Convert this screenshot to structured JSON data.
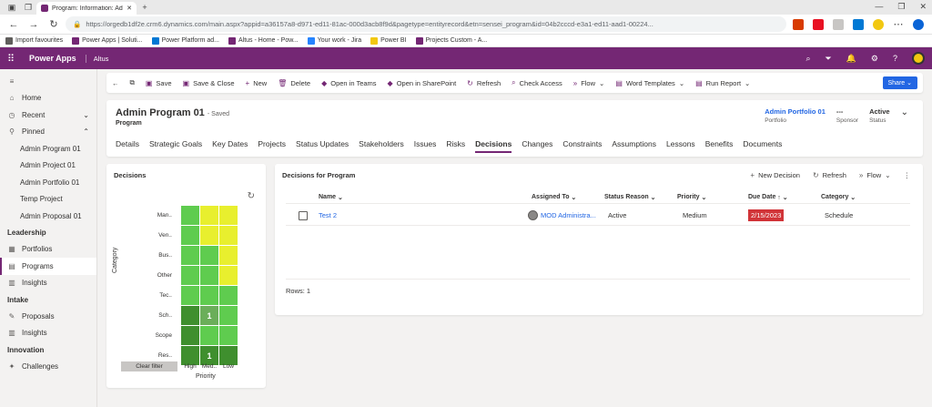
{
  "browser": {
    "tab_title": "Program: Information: Admin Pr",
    "url": "https://orgedb1df2e.crm6.dynamics.com/main.aspx?appid=a36157a8-d971-ed11-81ac-000d3acb8f9d&pagetype=entityrecord&etn=sensei_program&id=04b2cccd-e3a1-ed11-aad1-00224...",
    "bookmarks": [
      "Import favourites",
      "Power Apps | Soluti...",
      "Power Platform ad...",
      "Altus - Home - Pow...",
      "Your work - Jira",
      "Power BI",
      "Projects Custom - A..."
    ]
  },
  "app": {
    "name": "Power Apps",
    "environment": "Altus"
  },
  "sidebar": {
    "top": [
      {
        "label": "Home",
        "icon": "home-icon"
      },
      {
        "label": "Recent",
        "icon": "clock-icon"
      },
      {
        "label": "Pinned",
        "icon": "pin-icon"
      }
    ],
    "pinned": [
      "Admin Program 01",
      "Admin Project 01",
      "Admin Portfolio 01",
      "Temp Project",
      "Admin Proposal 01"
    ],
    "groups": [
      {
        "title": "Leadership",
        "items": [
          "Portfolios",
          "Programs",
          "Insights"
        ]
      },
      {
        "title": "Intake",
        "items": [
          "Proposals",
          "Insights"
        ]
      },
      {
        "title": "Innovation",
        "items": [
          "Challenges"
        ]
      }
    ]
  },
  "commands": [
    "Save",
    "Save & Close",
    "New",
    "Delete",
    "Open in Teams",
    "Open in SharePoint",
    "Refresh",
    "Check Access",
    "Flow",
    "Word Templates",
    "Run Report"
  ],
  "share_label": "Share",
  "form": {
    "title": "Admin Program 01",
    "saved": "- Saved",
    "entity": "Program",
    "portfolio_value": "Admin Portfolio 01",
    "portfolio_label": "Portfolio",
    "sponsor_value": "---",
    "sponsor_label": "Sponsor",
    "status_value": "Active",
    "status_label": "Status",
    "tabs": [
      "Details",
      "Strategic Goals",
      "Key Dates",
      "Projects",
      "Status Updates",
      "Stakeholders",
      "Issues",
      "Risks",
      "Decisions",
      "Changes",
      "Constraints",
      "Assumptions",
      "Lessons",
      "Benefits",
      "Documents"
    ],
    "selected_tab": "Decisions"
  },
  "heatmap": {
    "title": "Decisions",
    "y_axis": "Category",
    "x_axis": "Priority",
    "rows": [
      "Man..",
      "Ven..",
      "Bus..",
      "Other",
      "Tec..",
      "Sch..",
      "Scope",
      "Res.."
    ],
    "cols": [
      "High",
      "Med..",
      "Low"
    ],
    "cells": [
      [
        {
          "c": "#5fcc4f",
          "v": ""
        },
        {
          "c": "#e8ef2e",
          "v": ""
        },
        {
          "c": "#e8ef2e",
          "v": ""
        }
      ],
      [
        {
          "c": "#5fcc4f",
          "v": ""
        },
        {
          "c": "#e8ef2e",
          "v": ""
        },
        {
          "c": "#e8ef2e",
          "v": ""
        }
      ],
      [
        {
          "c": "#5fcc4f",
          "v": ""
        },
        {
          "c": "#5fcc4f",
          "v": ""
        },
        {
          "c": "#e8ef2e",
          "v": ""
        }
      ],
      [
        {
          "c": "#5fcc4f",
          "v": ""
        },
        {
          "c": "#5fcc4f",
          "v": ""
        },
        {
          "c": "#e8ef2e",
          "v": ""
        }
      ],
      [
        {
          "c": "#5fcc4f",
          "v": ""
        },
        {
          "c": "#5fcc4f",
          "v": ""
        },
        {
          "c": "#5fcc4f",
          "v": ""
        }
      ],
      [
        {
          "c": "#3f8f2e",
          "v": ""
        },
        {
          "c": "#6bae5a",
          "v": "1"
        },
        {
          "c": "#5fcc4f",
          "v": ""
        }
      ],
      [
        {
          "c": "#3f8f2e",
          "v": ""
        },
        {
          "c": "#5fcc4f",
          "v": ""
        },
        {
          "c": "#5fcc4f",
          "v": ""
        }
      ],
      [
        {
          "c": "#3f8f2e",
          "v": ""
        },
        {
          "c": "#3f8f2e",
          "v": "1"
        },
        {
          "c": "#3f8f2e",
          "v": ""
        }
      ]
    ],
    "clear_filter": "Clear filter"
  },
  "grid": {
    "title": "Decisions for Program",
    "actions": [
      "New Decision",
      "Refresh",
      "Flow"
    ],
    "columns": [
      "Name",
      "Assigned To",
      "Status Reason",
      "Priority",
      "Due Date",
      "Category"
    ],
    "rows": [
      {
        "name": "Test 2",
        "assigned": "MOD Administra...",
        "status": "Active",
        "priority": "Medium",
        "due": "2/15/2023",
        "category": "Schedule"
      }
    ],
    "footer": "Rows: 1"
  }
}
